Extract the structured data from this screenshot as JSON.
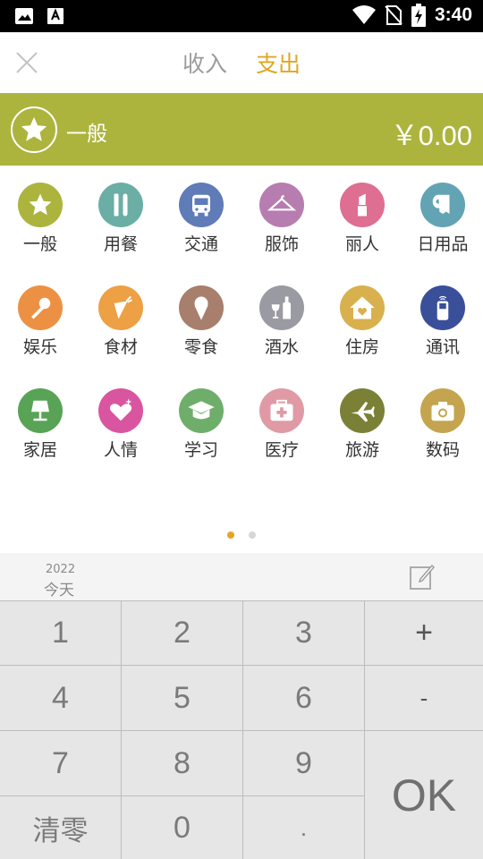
{
  "status_bar": {
    "time": "3:40"
  },
  "header": {
    "tabs": [
      {
        "label": "收入",
        "active": false
      },
      {
        "label": "支出",
        "active": true
      }
    ]
  },
  "banner": {
    "category": "一般",
    "amount": "￥0.00",
    "color": "#acb43e"
  },
  "categories": [
    {
      "label": "一般",
      "icon": "star-icon",
      "color": "#acb43e"
    },
    {
      "label": "用餐",
      "icon": "fork-knife-icon",
      "color": "#6aaea5"
    },
    {
      "label": "交通",
      "icon": "bus-icon",
      "color": "#5f7cb8"
    },
    {
      "label": "服饰",
      "icon": "hanger-icon",
      "color": "#b77db0"
    },
    {
      "label": "丽人",
      "icon": "lipstick-icon",
      "color": "#de6e92"
    },
    {
      "label": "日用品",
      "icon": "toilet-paper-icon",
      "color": "#63a4b4"
    },
    {
      "label": "娱乐",
      "icon": "microphone-icon",
      "color": "#ec9143"
    },
    {
      "label": "食材",
      "icon": "carrot-icon",
      "color": "#eda044"
    },
    {
      "label": "零食",
      "icon": "ice-cream-icon",
      "color": "#a87e6c"
    },
    {
      "label": "酒水",
      "icon": "wine-bottle-icon",
      "color": "#9a9aa2"
    },
    {
      "label": "住房",
      "icon": "house-icon",
      "color": "#d8b14e"
    },
    {
      "label": "通讯",
      "icon": "mobile-phone-icon",
      "color": "#3a4f9a"
    },
    {
      "label": "家居",
      "icon": "lamp-icon",
      "color": "#58a356"
    },
    {
      "label": "人情",
      "icon": "heart-gift-icon",
      "color": "#d9559f"
    },
    {
      "label": "学习",
      "icon": "graduation-cap-icon",
      "color": "#6fae6a"
    },
    {
      "label": "医疗",
      "icon": "first-aid-kit-icon",
      "color": "#df9aa5"
    },
    {
      "label": "旅游",
      "icon": "airplane-icon",
      "color": "#7a8136"
    },
    {
      "label": "数码",
      "icon": "camera-icon",
      "color": "#c4a44e"
    }
  ],
  "pager": {
    "pages": 2,
    "current": 1,
    "active_color": "#e2a624",
    "inactive_color": "#d6d6d6"
  },
  "date": {
    "year": "2022",
    "day": "今天"
  },
  "keypad": {
    "keys": [
      "1",
      "2",
      "3",
      "+",
      "4",
      "5",
      "6",
      "-",
      "7",
      "8",
      "9",
      "OK",
      "清零",
      "0",
      "."
    ]
  }
}
